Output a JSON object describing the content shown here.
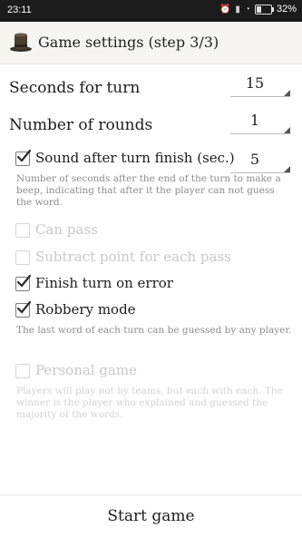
{
  "statusbar": {
    "time": "23:11",
    "battery": "32%",
    "battery_level": 0.32,
    "icons": [
      "alarm-icon",
      "signal-icon",
      "wifi-icon",
      "battery-icon"
    ]
  },
  "appbar": {
    "title": "Game settings (step 3/3)",
    "icon": "top-hat-icon"
  },
  "settings": {
    "seconds_for_turn": {
      "label": "Seconds for turn",
      "value": "15"
    },
    "number_of_rounds": {
      "label": "Number of rounds",
      "value": "1"
    },
    "sound_after_turn": {
      "label": "Sound after turn finish (sec.)",
      "value": "5",
      "checked": true,
      "description": "Number of seconds after the end of the turn to make a beep, indicating that after it the player can not guess the word."
    },
    "can_pass": {
      "label": "Can pass",
      "checked": false,
      "enabled": false
    },
    "subtract_point": {
      "label": "Subtract point for each pass",
      "checked": false,
      "enabled": false
    },
    "finish_on_error": {
      "label": "Finish turn on error",
      "checked": true,
      "enabled": true
    },
    "robbery_mode": {
      "label": "Robbery mode",
      "checked": true,
      "enabled": true,
      "description": "The last word of each turn can be guessed by any player."
    },
    "personal_game": {
      "label": "Personal game",
      "checked": false,
      "enabled": false,
      "description": "Players will play not by teams, but each with each. The winner is the player who explained and guessed the majority of the words."
    }
  },
  "footer": {
    "start_label": "Start game"
  }
}
